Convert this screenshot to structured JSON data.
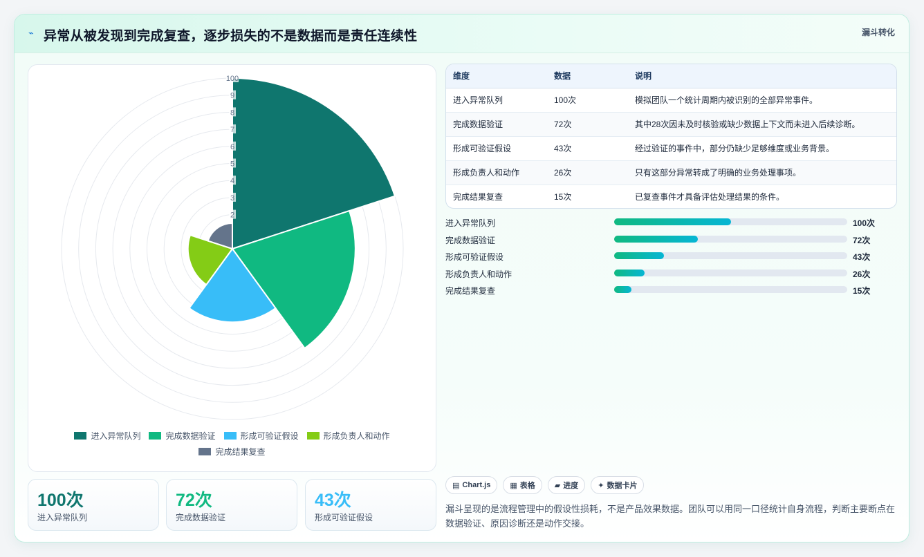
{
  "header": {
    "title": "异常从被发现到完成复查，逐步损失的不是数据而是责任连续性",
    "tag": "漏斗转化"
  },
  "colors": {
    "series": [
      "#0f766e",
      "#10b981",
      "#38bdf8",
      "#84cc16",
      "#64748b"
    ]
  },
  "chart_data": {
    "type": "polarArea",
    "categories": [
      "进入异常队列",
      "完成数据验证",
      "形成可验证假设",
      "形成负责人和动作",
      "完成结果复查"
    ],
    "values": [
      100,
      72,
      43,
      26,
      15
    ],
    "r_range": [
      0,
      100
    ],
    "r_ticks": [
      "100",
      "9",
      "8",
      "7",
      "6",
      "5",
      "4",
      "3",
      "2"
    ],
    "grid": true,
    "legend_position": "bottom"
  },
  "legend": [
    "进入异常队列",
    "完成数据验证",
    "形成可验证假设",
    "形成负责人和动作",
    "完成结果复查"
  ],
  "kpis": [
    {
      "value": "100次",
      "label": "进入异常队列",
      "color": "#0f766e"
    },
    {
      "value": "72次",
      "label": "完成数据验证",
      "color": "#10b981"
    },
    {
      "value": "43次",
      "label": "形成可验证假设",
      "color": "#38bdf8"
    }
  ],
  "table": {
    "headers": [
      "维度",
      "数据",
      "说明"
    ],
    "rows": [
      [
        "进入异常队列",
        "100次",
        "模拟团队一个统计周期内被识别的全部异常事件。"
      ],
      [
        "完成数据验证",
        "72次",
        "其中28次因未及时核验或缺少数据上下文而未进入后续诊断。"
      ],
      [
        "形成可验证假设",
        "43次",
        "经过验证的事件中，部分仍缺少足够维度或业务背景。"
      ],
      [
        "形成负责人和动作",
        "26次",
        "只有这部分异常转成了明确的业务处理事项。"
      ],
      [
        "完成结果复查",
        "15次",
        "已复查事件才具备评估处理结果的条件。"
      ]
    ]
  },
  "progress": [
    {
      "label": "进入异常队列",
      "value": 100,
      "text": "100次"
    },
    {
      "label": "完成数据验证",
      "value": 72,
      "text": "72次"
    },
    {
      "label": "形成可验证假设",
      "value": 43,
      "text": "43次"
    },
    {
      "label": "形成负责人和动作",
      "value": 26,
      "text": "26次"
    },
    {
      "label": "完成结果复查",
      "value": 15,
      "text": "15次"
    }
  ],
  "chips": [
    {
      "icon": "▤",
      "label": "Chart.js"
    },
    {
      "icon": "▦",
      "label": "表格"
    },
    {
      "icon": "▰",
      "label": "进度"
    },
    {
      "icon": "✦",
      "label": "数据卡片"
    }
  ],
  "note": "漏斗呈现的是流程管理中的假设性损耗，不是产品效果数据。团队可以用同一口径统计自身流程，判断主要断点在数据验证、原因诊断还是动作交接。"
}
